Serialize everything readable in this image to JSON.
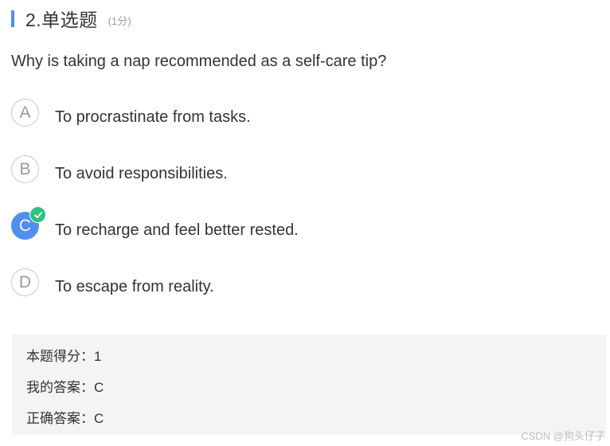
{
  "question": {
    "number_title": "2.单选题",
    "score_note": "(1分)",
    "stem": "Why is taking a nap recommended as a self-care tip?"
  },
  "options": [
    {
      "letter": "A",
      "text": "To procrastinate from tasks.",
      "selected": false
    },
    {
      "letter": "B",
      "text": "To avoid responsibilities.",
      "selected": false
    },
    {
      "letter": "C",
      "text": "To recharge and feel better rested.",
      "selected": true
    },
    {
      "letter": "D",
      "text": "To escape from reality.",
      "selected": false
    }
  ],
  "result": {
    "score_line": "本题得分：1",
    "my_answer_line": "我的答案：C",
    "correct_answer_line": "正确答案：C"
  },
  "watermark": "CSDN @狗头仔子",
  "colors": {
    "accent": "#4e8ff0",
    "check": "#2ec27e",
    "result_bg": "#f4f4f4"
  },
  "icons": {
    "correct_badge": "check-circle-icon",
    "title_marker": "accent-bar"
  }
}
